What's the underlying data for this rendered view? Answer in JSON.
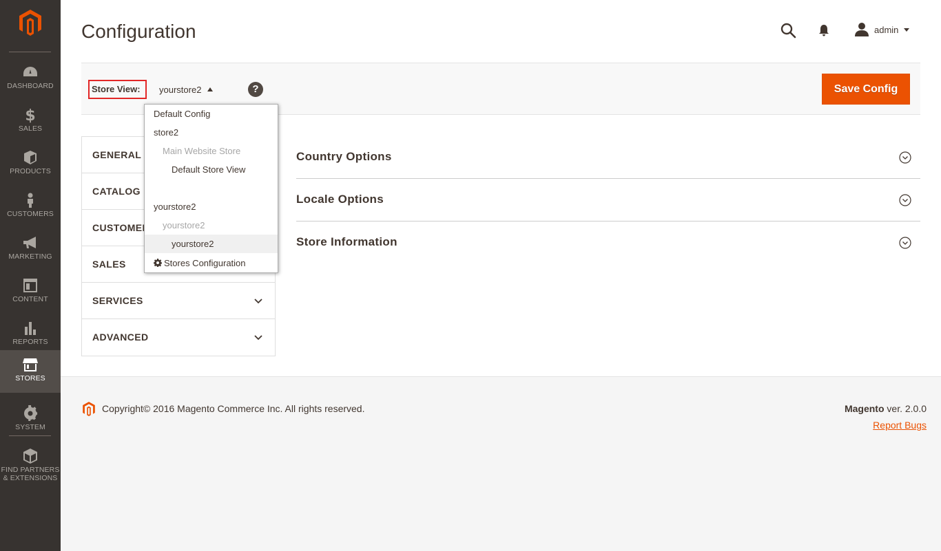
{
  "sidebar": {
    "items": [
      {
        "label": "DASHBOARD",
        "icon": "dashboard-icon"
      },
      {
        "label": "SALES",
        "icon": "dollar-icon"
      },
      {
        "label": "PRODUCTS",
        "icon": "box-icon"
      },
      {
        "label": "CUSTOMERS",
        "icon": "person-icon"
      },
      {
        "label": "MARKETING",
        "icon": "megaphone-icon"
      },
      {
        "label": "CONTENT",
        "icon": "layout-icon"
      },
      {
        "label": "REPORTS",
        "icon": "bar-chart-icon"
      },
      {
        "label": "STORES",
        "icon": "storefront-icon"
      },
      {
        "label": "SYSTEM",
        "icon": "gear-icon"
      },
      {
        "label": "FIND PARTNERS",
        "label2": "& EXTENSIONS",
        "icon": "cube-icon"
      }
    ],
    "active": "STORES"
  },
  "header": {
    "title": "Configuration",
    "user": "admin"
  },
  "scope": {
    "label": "Store View:",
    "current": "yourstore2",
    "help": "?",
    "save_label": "Save Config"
  },
  "dropdown": {
    "items": [
      {
        "label": "Default Config",
        "level": 0
      },
      {
        "label": "store2",
        "level": 0
      },
      {
        "label": "Main Website Store",
        "level": 1
      },
      {
        "label": "Default Store View",
        "level": 2
      },
      {
        "label": "yourstore2",
        "level": 0
      },
      {
        "label": "yourstore2",
        "level": 1
      },
      {
        "label": "yourstore2",
        "level": 2,
        "selected": true
      },
      {
        "label": "Stores Configuration",
        "level": 0
      }
    ]
  },
  "tabs": [
    {
      "label": "GENERAL"
    },
    {
      "label": "CATALOG"
    },
    {
      "label": "CUSTOMERS"
    },
    {
      "label": "SALES"
    },
    {
      "label": "SERVICES"
    },
    {
      "label": "ADVANCED"
    }
  ],
  "sections": [
    {
      "title": "Country Options"
    },
    {
      "title": "Locale Options"
    },
    {
      "title": "Store Information"
    }
  ],
  "footer": {
    "copyright": "Copyright© 2016 Magento Commerce Inc. All rights reserved.",
    "brand": "Magento",
    "version": "ver. 2.0.0",
    "report_bugs": "Report Bugs"
  },
  "colors": {
    "accent": "#eb5202",
    "sidebar": "#373330",
    "highlight_border": "#e22626"
  }
}
